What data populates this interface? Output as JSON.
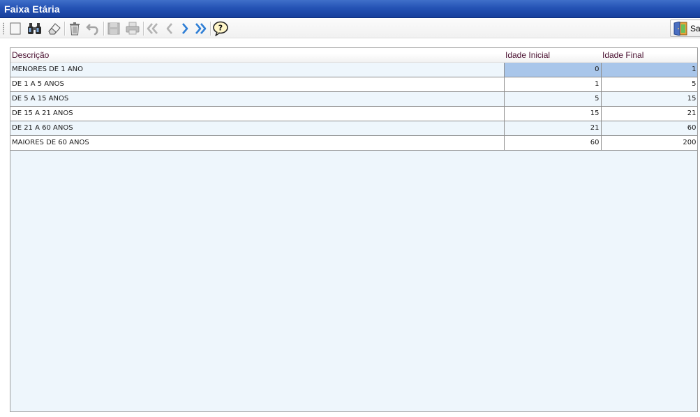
{
  "window": {
    "title": "Faixa Etária"
  },
  "toolbar": {
    "buttons": [
      {
        "icon": "new-record-icon"
      },
      {
        "icon": "binoculars-icon"
      },
      {
        "icon": "eraser-icon"
      },
      {
        "icon": "trash-icon"
      },
      {
        "icon": "undo-icon"
      },
      {
        "icon": "save-icon"
      },
      {
        "icon": "print-icon"
      },
      {
        "icon": "first-record-icon"
      },
      {
        "icon": "previous-record-icon"
      },
      {
        "icon": "next-record-icon"
      },
      {
        "icon": "last-record-icon"
      },
      {
        "icon": "help-icon"
      }
    ],
    "exit_label": "Sair"
  },
  "grid": {
    "columns": [
      "Descrição",
      "Idade Inicial",
      "Idade Final"
    ],
    "rows": [
      {
        "descricao": "MENORES DE 1 ANO",
        "idade_inicial": "0",
        "idade_final": "1"
      },
      {
        "descricao": "DE 1 A 5 ANOS",
        "idade_inicial": "1",
        "idade_final": "5"
      },
      {
        "descricao": "DE 5 A 15 ANOS",
        "idade_inicial": "5",
        "idade_final": "15"
      },
      {
        "descricao": "DE 15 A 21 ANOS",
        "idade_inicial": "15",
        "idade_final": "21"
      },
      {
        "descricao": "DE 21 A 60 ANOS",
        "idade_inicial": "21",
        "idade_final": "60"
      },
      {
        "descricao": "MAIORES DE 60 ANOS",
        "idade_inicial": "60",
        "idade_final": "200"
      }
    ],
    "selected_row": 0
  },
  "colors": {
    "title_bar": "#2553b5",
    "grid_background": "#eef6fc",
    "selection": "#a9c6ea",
    "header_text": "#4a1030"
  }
}
